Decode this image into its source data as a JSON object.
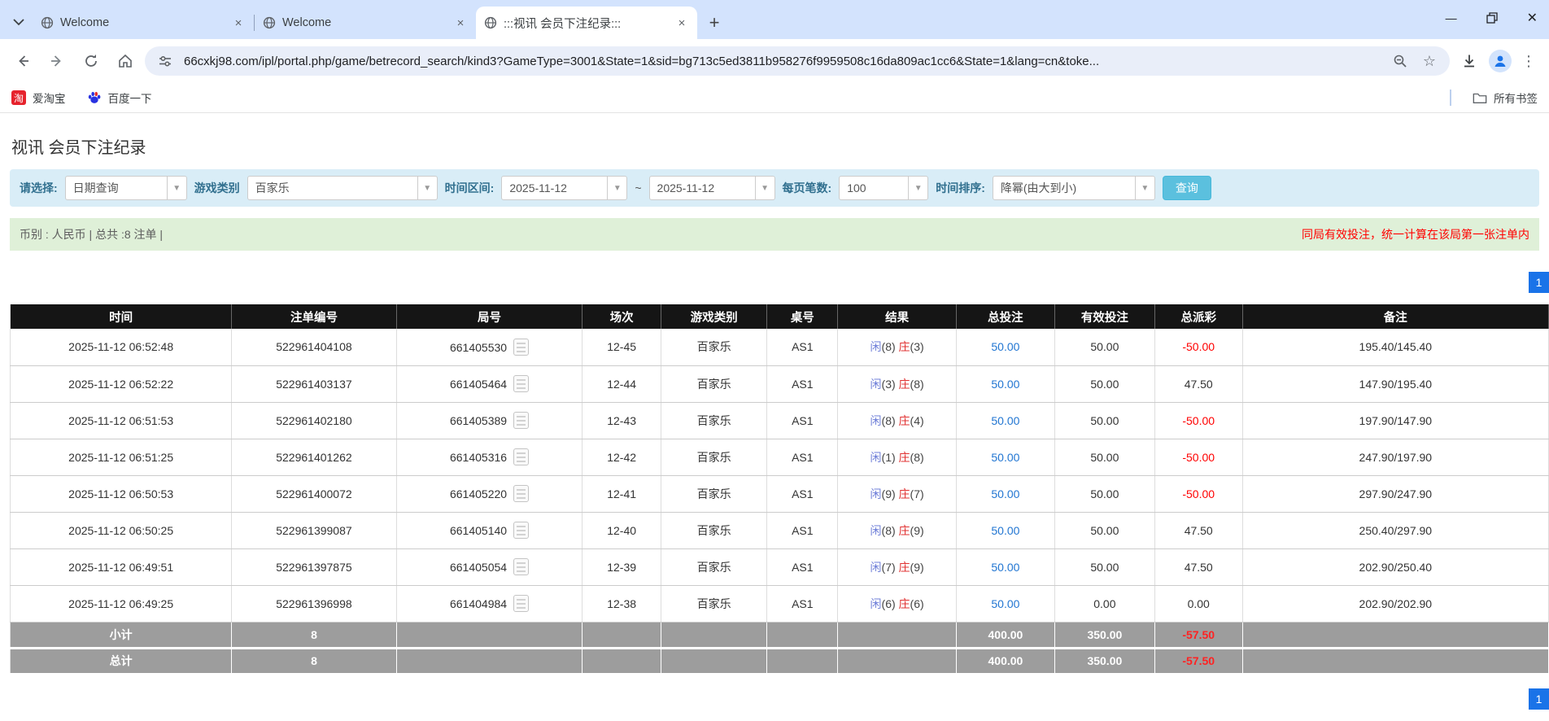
{
  "colors": {
    "chrome_bg": "#d3e3fd",
    "accent_blue": "#1a73e8",
    "link_blue": "#2276d2",
    "player_blue": "#6f7fd8",
    "banker_red": "#e03131",
    "neg_red": "#ff0000",
    "filter_bg": "#d9edf7",
    "filter_label": "#31708f",
    "summary_bg": "#dff0d8",
    "btn_bg": "#5bc0de",
    "header_bg": "#151515",
    "footer_bg": "#9d9d9d"
  },
  "icons": {
    "close": "×",
    "new_tab": "+",
    "minimize": "—",
    "window_close": "✕",
    "more_vert": "⋮",
    "star": "☆",
    "dropdown_arrow": "▼",
    "tilde": "~",
    "pipe_divider": "|"
  },
  "browser": {
    "tabs": [
      {
        "title": "Welcome"
      },
      {
        "title": "Welcome"
      },
      {
        "title": ":::视讯 会员下注纪录:::"
      }
    ],
    "url": "66cxkj98.com/ipl/portal.php/game/betrecord_search/kind3?GameType=3001&State=1&sid=bg713c5ed3811b958276f9959508c16da809ac1cc6&State=1&lang=cn&toke...",
    "bookmarks": [
      {
        "label": "爱淘宝",
        "badge": "淘"
      },
      {
        "label": "百度一下"
      }
    ],
    "all_bookmarks_label": "所有书签"
  },
  "page": {
    "title": "视讯 会员下注纪录",
    "filters": {
      "select_label": "请选择:",
      "select_value": "日期查询",
      "game_type_label": "游戏类别",
      "game_type_value": "百家乐",
      "date_range_label": "时间区间:",
      "date_from": "2025-11-12",
      "date_to": "2025-11-12",
      "range_separator": "~",
      "page_size_label": "每页笔数:",
      "page_size_value": "100",
      "sort_label": "时间排序:",
      "sort_value": "降幂(由大到小)",
      "search_button": "查询"
    },
    "summary": {
      "left": "币别 : 人民币 | 总共 :8 注单 |",
      "right_notice": "同局有效投注，统一计算在该局第一张注单内"
    },
    "pagination": "1",
    "table": {
      "headers": [
        "时间",
        "注单编号",
        "局号",
        "场次",
        "游戏类别",
        "桌号",
        "结果",
        "总投注",
        "有效投注",
        "总派彩",
        "备注"
      ],
      "rows": [
        {
          "time": "2025-11-12 06:52:48",
          "bet_no": "522961404108",
          "round_no": "661405530",
          "session": "12-45",
          "game": "百家乐",
          "table_no": "AS1",
          "result": {
            "player": "闲",
            "player_points": "(8)",
            "banker": "庄",
            "banker_points": "(3)"
          },
          "total_bet": "50.00",
          "valid_bet": "50.00",
          "payout": "-50.00",
          "note": "195.40/145.40"
        },
        {
          "time": "2025-11-12 06:52:22",
          "bet_no": "522961403137",
          "round_no": "661405464",
          "session": "12-44",
          "game": "百家乐",
          "table_no": "AS1",
          "result": {
            "player": "闲",
            "player_points": "(3)",
            "banker": "庄",
            "banker_points": "(8)"
          },
          "total_bet": "50.00",
          "valid_bet": "50.00",
          "payout": "47.50",
          "note": "147.90/195.40"
        },
        {
          "time": "2025-11-12 06:51:53",
          "bet_no": "522961402180",
          "round_no": "661405389",
          "session": "12-43",
          "game": "百家乐",
          "table_no": "AS1",
          "result": {
            "player": "闲",
            "player_points": "(8)",
            "banker": "庄",
            "banker_points": "(4)"
          },
          "total_bet": "50.00",
          "valid_bet": "50.00",
          "payout": "-50.00",
          "note": "197.90/147.90"
        },
        {
          "time": "2025-11-12 06:51:25",
          "bet_no": "522961401262",
          "round_no": "661405316",
          "session": "12-42",
          "game": "百家乐",
          "table_no": "AS1",
          "result": {
            "player": "闲",
            "player_points": "(1)",
            "banker": "庄",
            "banker_points": "(8)"
          },
          "total_bet": "50.00",
          "valid_bet": "50.00",
          "payout": "-50.00",
          "note": "247.90/197.90"
        },
        {
          "time": "2025-11-12 06:50:53",
          "bet_no": "522961400072",
          "round_no": "661405220",
          "session": "12-41",
          "game": "百家乐",
          "table_no": "AS1",
          "result": {
            "player": "闲",
            "player_points": "(9)",
            "banker": "庄",
            "banker_points": "(7)"
          },
          "total_bet": "50.00",
          "valid_bet": "50.00",
          "payout": "-50.00",
          "note": "297.90/247.90"
        },
        {
          "time": "2025-11-12 06:50:25",
          "bet_no": "522961399087",
          "round_no": "661405140",
          "session": "12-40",
          "game": "百家乐",
          "table_no": "AS1",
          "result": {
            "player": "闲",
            "player_points": "(8)",
            "banker": "庄",
            "banker_points": "(9)"
          },
          "total_bet": "50.00",
          "valid_bet": "50.00",
          "payout": "47.50",
          "note": "250.40/297.90"
        },
        {
          "time": "2025-11-12 06:49:51",
          "bet_no": "522961397875",
          "round_no": "661405054",
          "session": "12-39",
          "game": "百家乐",
          "table_no": "AS1",
          "result": {
            "player": "闲",
            "player_points": "(7)",
            "banker": "庄",
            "banker_points": "(9)"
          },
          "total_bet": "50.00",
          "valid_bet": "50.00",
          "payout": "47.50",
          "note": "202.90/250.40"
        },
        {
          "time": "2025-11-12 06:49:25",
          "bet_no": "522961396998",
          "round_no": "661404984",
          "session": "12-38",
          "game": "百家乐",
          "table_no": "AS1",
          "result": {
            "player": "闲",
            "player_points": "(6)",
            "banker": "庄",
            "banker_points": "(6)"
          },
          "total_bet": "50.00",
          "valid_bet": "0.00",
          "payout": "0.00",
          "note": "202.90/202.90"
        }
      ],
      "subtotal": {
        "label": "小计",
        "count": "8",
        "total_bet": "400.00",
        "valid_bet": "350.00",
        "payout": "-57.50"
      },
      "total": {
        "label": "总计",
        "count": "8",
        "total_bet": "400.00",
        "valid_bet": "350.00",
        "payout": "-57.50"
      }
    }
  }
}
